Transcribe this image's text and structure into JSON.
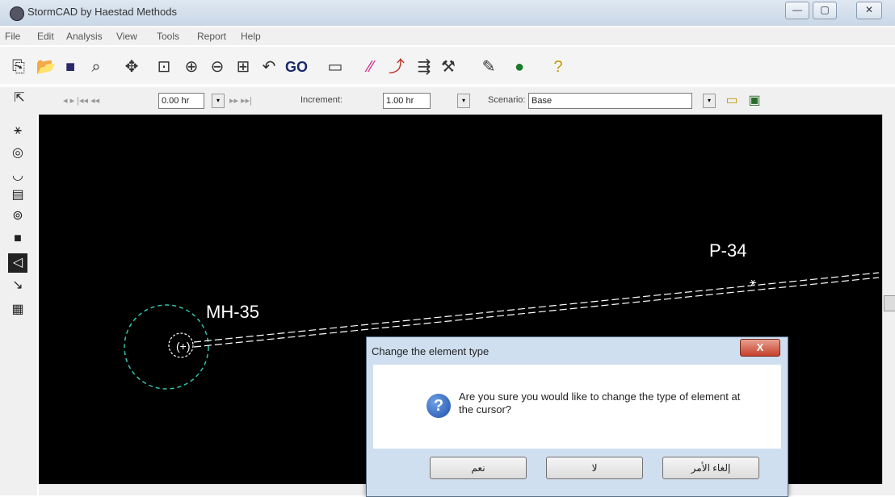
{
  "window": {
    "title": "StormCAD by Haestad Methods",
    "btn_minimize": "—",
    "btn_maximize": "▢",
    "btn_close": "✕"
  },
  "menu": [
    "File",
    "Edit",
    "Analysis",
    "View",
    "Tools",
    "Report",
    "Help"
  ],
  "toolbar": {
    "icons": [
      "new-icon",
      "open-icon",
      "save-icon",
      "print-preview-icon",
      "pan-icon",
      "zoom-extents-icon",
      "zoom-in-icon",
      "zoom-out-icon",
      "zoom-window-icon",
      "zoom-previous-icon",
      "go-button",
      "table-icon",
      "color-coding-icon",
      "profile-icon",
      "annotation-icon",
      "element-tool-icon",
      "report-icon",
      "globe-icon",
      "help-icon"
    ],
    "go_label": "GO"
  },
  "toolbar2": {
    "time_value": "0.00 hr",
    "increment_label": "Increment:",
    "increment_value": "1.00 hr",
    "scenario_label": "Scenario:",
    "scenario_value": "Base"
  },
  "canvas": {
    "label_manhole": "MH-35",
    "label_pipe": "P-34",
    "node_glyph": "(+)"
  },
  "dialog": {
    "title": "Change the element type",
    "close": "X",
    "message": "Are you sure you would like to change the type of element at the cursor?",
    "btn_yes": "نعم",
    "btn_no": "لا",
    "btn_cancel": "إلغاء الأمر"
  }
}
